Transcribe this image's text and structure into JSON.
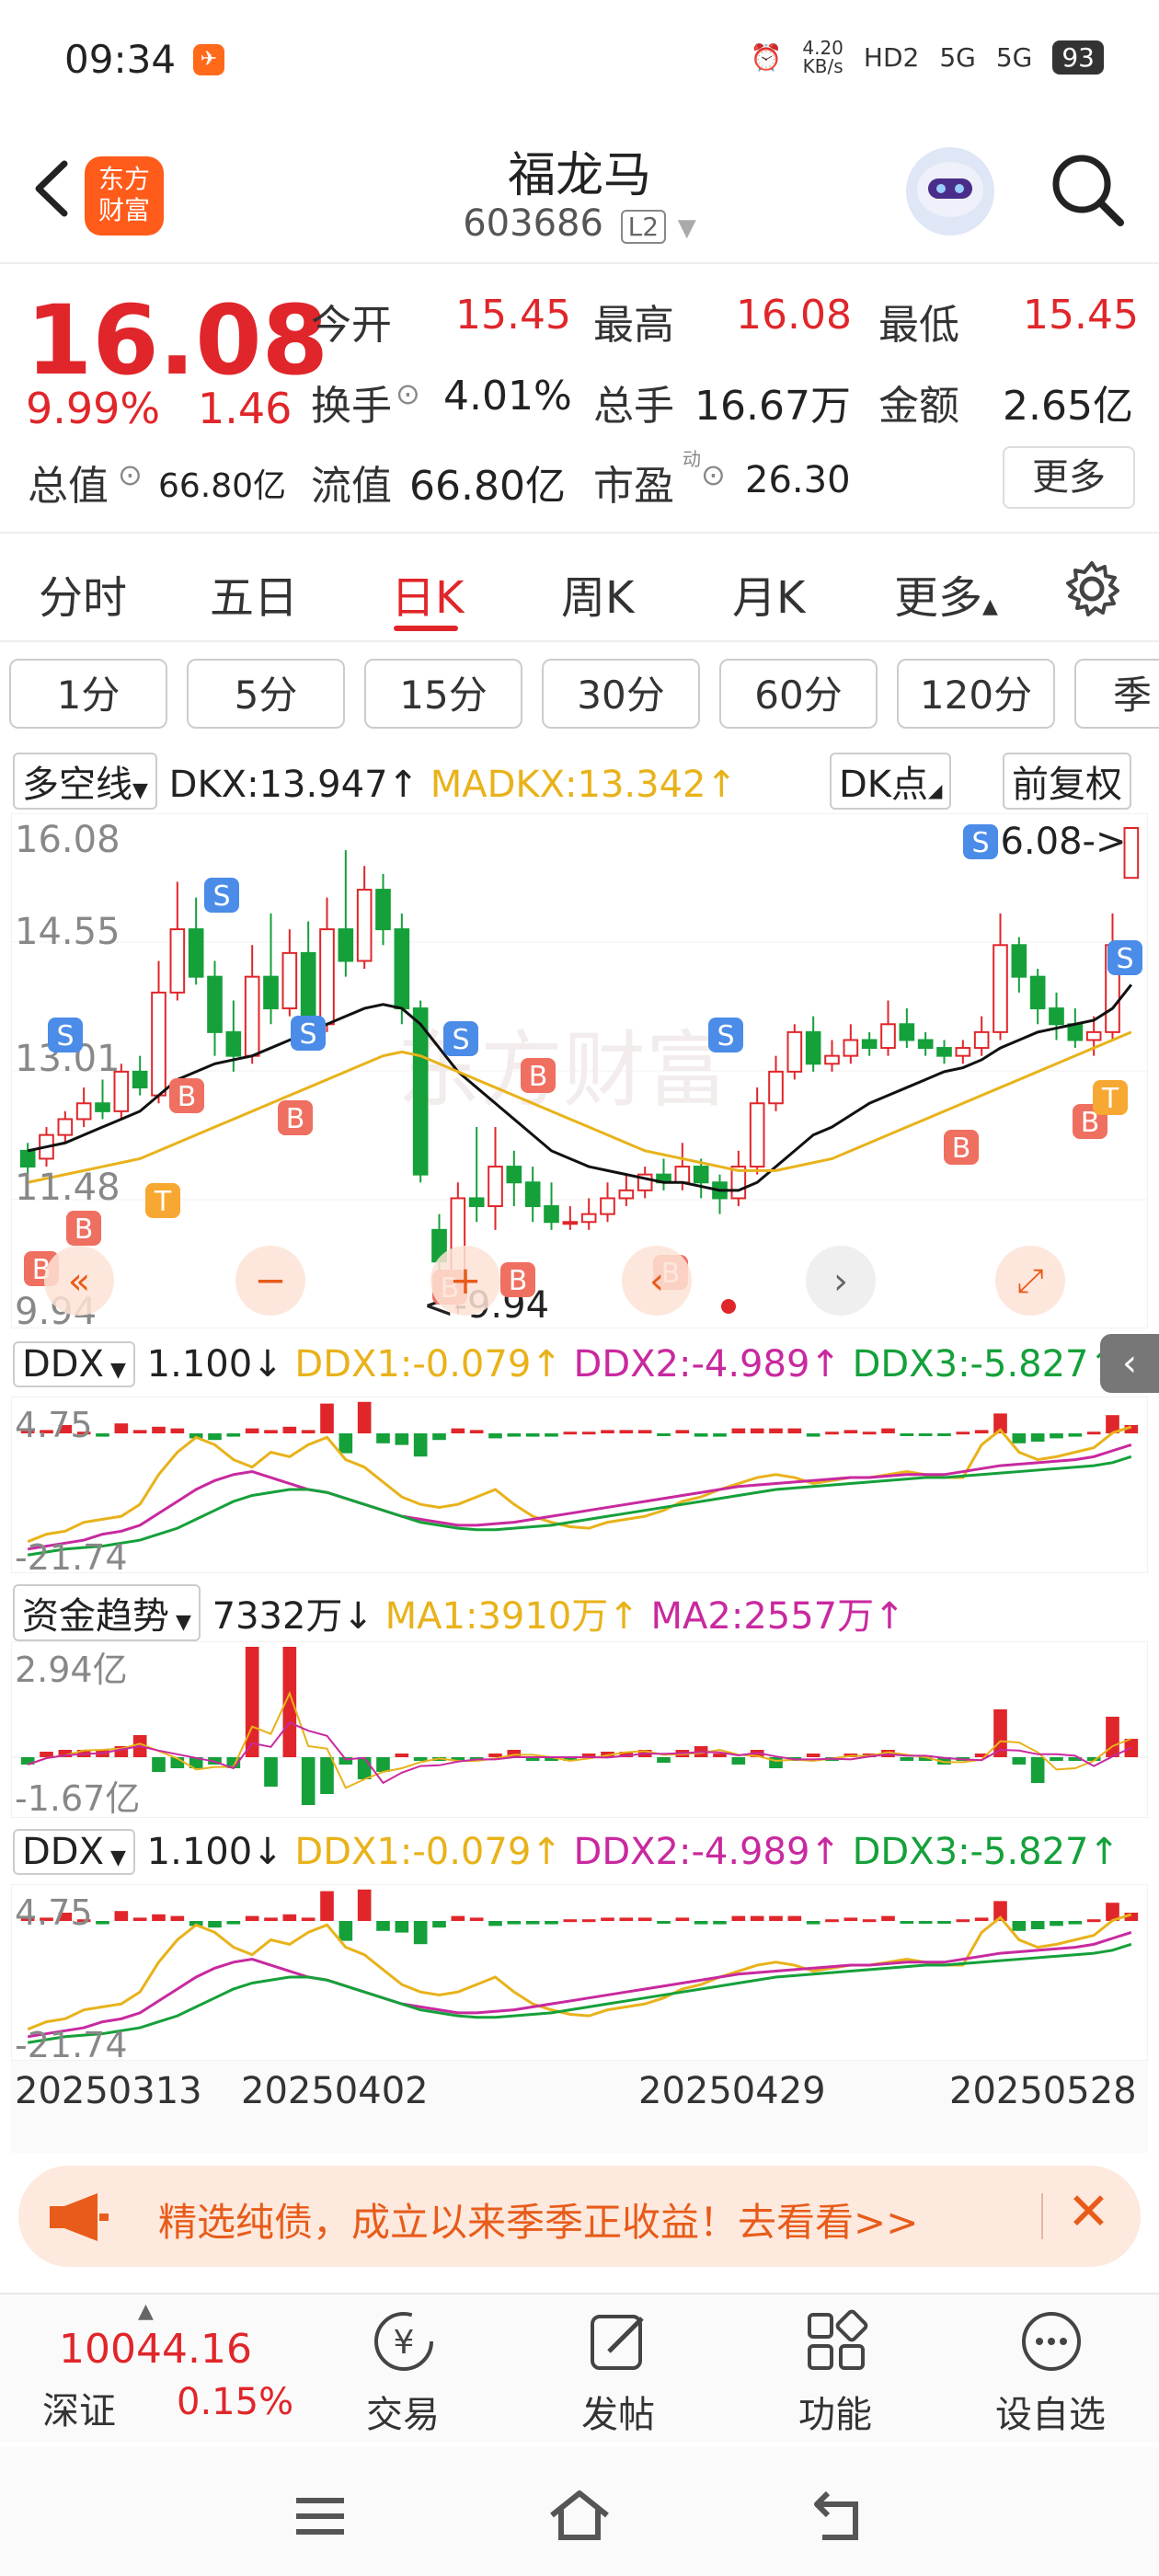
{
  "status_bar": {
    "time": "09:34",
    "net_speed": "4.20\nKB/s",
    "net_speed_top": "4.20",
    "net_speed_unit": "KB/s",
    "hd": "HD2",
    "signal1": "5G",
    "signal2": "5G",
    "battery": "93"
  },
  "header": {
    "brand_line1": "东方",
    "brand_line2": "财富",
    "stock_name": "福龙马",
    "stock_code": "603686",
    "level": "L2"
  },
  "quote": {
    "price": "16.08",
    "change_pct": "9.99%",
    "change": "1.46",
    "open_label": "今开",
    "open": "15.45",
    "high_label": "最高",
    "high": "16.08",
    "low_label": "最低",
    "low": "15.45",
    "turnover_label": "换手",
    "turnover": "4.01%",
    "volume_label": "总手",
    "volume": "16.67万",
    "amount_label": "金额",
    "amount": "2.65亿",
    "total_value_label": "总值",
    "total_value": "66.80亿",
    "float_value_label": "流值",
    "float_value": "66.80亿",
    "pe_label": "市盈",
    "pe_sup": "动",
    "pe": "26.30",
    "more_label": "更多"
  },
  "period_tabs": [
    "分时",
    "五日",
    "日K",
    "周K",
    "月K",
    "更多"
  ],
  "active_tab": "日K",
  "minute_buttons": [
    "1分",
    "5分",
    "15分",
    "30分",
    "60分",
    "120分",
    "季"
  ],
  "main_chart": {
    "indicator": "多空线",
    "dkx": "DKX:13.947",
    "madkx": "MADKX:13.342",
    "dk_button": "DK点",
    "adjust_button": "前复权",
    "y_labels": [
      "16.08",
      "14.55",
      "13.01",
      "11.48",
      "9.94"
    ],
    "max_label": "16.08->",
    "min_label": "<-9.94",
    "watermark": "东方财富"
  },
  "ddx_panel_1": {
    "name": "DDX",
    "ddx": "1.100",
    "ddx1": "DDX1:-0.079",
    "ddx2": "DDX2:-4.989",
    "ddx3": "DDX3:-5.827",
    "y_top": "4.75",
    "y_bottom": "-21.74"
  },
  "fund_panel": {
    "name": "资金趋势",
    "value": "7332万",
    "ma1": "MA1:3910万",
    "ma2": "MA2:2557万",
    "y_top": "2.94亿",
    "y_bottom": "-1.67亿"
  },
  "ddx_panel_2": {
    "name": "DDX",
    "ddx": "1.100",
    "ddx1": "DDX1:-0.079",
    "ddx2": "DDX2:-4.989",
    "ddx3": "DDX3:-5.827",
    "y_top": "4.75",
    "y_bottom": "-21.74"
  },
  "dates": [
    "20250313",
    "20250402",
    "20250429",
    "20250528"
  ],
  "banner": {
    "text": "精选纯债，成立以来季季正收益！去看看>>"
  },
  "bottom_nav": {
    "index_value": "10044.16",
    "index_name": "深证",
    "index_change": "0.15%",
    "items": [
      "交易",
      "发帖",
      "功能",
      "设自选"
    ]
  },
  "colors": {
    "up": "#e0262a",
    "down": "#15a03a",
    "dkx_line": "#111111",
    "madkx_line": "#e8b21a",
    "ddx2_line": "#c8299f",
    "accent": "#ff5b1a"
  },
  "chart_data": {
    "type": "candlestick",
    "ylim": [
      9.94,
      16.08
    ],
    "candles": [
      [
        12.0,
        11.8,
        12.1,
        11.7
      ],
      [
        11.9,
        12.2,
        12.3,
        11.8
      ],
      [
        12.2,
        12.4,
        12.5,
        12.1
      ],
      [
        12.4,
        12.6,
        12.8,
        12.3
      ],
      [
        12.6,
        12.5,
        12.9,
        12.4
      ],
      [
        12.5,
        13.0,
        13.1,
        12.4
      ],
      [
        13.0,
        12.8,
        13.2,
        12.7
      ],
      [
        12.7,
        14.0,
        14.4,
        12.6
      ],
      [
        14.0,
        14.8,
        15.4,
        13.9
      ],
      [
        14.8,
        14.2,
        15.2,
        14.1
      ],
      [
        14.2,
        13.5,
        14.4,
        13.2
      ],
      [
        13.5,
        13.2,
        13.9,
        13.0
      ],
      [
        13.2,
        14.2,
        14.6,
        13.1
      ],
      [
        14.2,
        13.8,
        15.0,
        13.6
      ],
      [
        13.8,
        14.5,
        14.8,
        13.7
      ],
      [
        14.5,
        13.6,
        14.9,
        13.4
      ],
      [
        13.6,
        14.8,
        15.2,
        13.5
      ],
      [
        14.8,
        14.4,
        15.8,
        14.2
      ],
      [
        14.4,
        15.3,
        15.6,
        14.3
      ],
      [
        15.3,
        14.8,
        15.5,
        14.6
      ],
      [
        14.8,
        13.8,
        15.0,
        13.6
      ],
      [
        13.8,
        11.7,
        13.9,
        11.6
      ],
      [
        11.0,
        10.6,
        11.2,
        10.4
      ],
      [
        10.4,
        11.4,
        11.6,
        9.94
      ],
      [
        11.4,
        11.3,
        12.3,
        11.1
      ],
      [
        11.3,
        11.8,
        12.3,
        11.0
      ],
      [
        11.8,
        11.6,
        12.0,
        11.3
      ],
      [
        11.6,
        11.3,
        11.8,
        11.1
      ],
      [
        11.3,
        11.1,
        11.6,
        11.0
      ],
      [
        11.1,
        11.1,
        11.3,
        11.0
      ],
      [
        11.1,
        11.2,
        11.4,
        11.0
      ],
      [
        11.2,
        11.4,
        11.6,
        11.1
      ],
      [
        11.4,
        11.5,
        11.7,
        11.3
      ],
      [
        11.5,
        11.7,
        11.8,
        11.4
      ],
      [
        11.7,
        11.6,
        11.9,
        11.5
      ],
      [
        11.6,
        11.8,
        12.1,
        11.5
      ],
      [
        11.8,
        11.6,
        11.9,
        11.4
      ],
      [
        11.6,
        11.4,
        11.7,
        11.2
      ],
      [
        11.4,
        11.8,
        12.0,
        11.3
      ],
      [
        11.8,
        12.6,
        12.8,
        11.7
      ],
      [
        12.6,
        13.0,
        13.2,
        12.5
      ],
      [
        13.0,
        13.5,
        13.6,
        12.9
      ],
      [
        13.5,
        13.1,
        13.7,
        13.0
      ],
      [
        13.1,
        13.2,
        13.4,
        13.0
      ],
      [
        13.2,
        13.4,
        13.6,
        13.1
      ],
      [
        13.4,
        13.3,
        13.5,
        13.2
      ],
      [
        13.3,
        13.6,
        13.9,
        13.2
      ],
      [
        13.6,
        13.4,
        13.8,
        13.3
      ],
      [
        13.4,
        13.3,
        13.5,
        13.2
      ],
      [
        13.3,
        13.2,
        13.4,
        13.1
      ],
      [
        13.2,
        13.3,
        13.4,
        13.1
      ],
      [
        13.3,
        13.5,
        13.7,
        13.2
      ],
      [
        13.5,
        14.6,
        15.0,
        13.4
      ],
      [
        14.6,
        14.2,
        14.7,
        14.0
      ],
      [
        14.2,
        13.8,
        14.3,
        13.6
      ],
      [
        13.8,
        13.6,
        14.0,
        13.4
      ],
      [
        13.6,
        13.4,
        13.8,
        13.3
      ],
      [
        13.4,
        13.5,
        13.7,
        13.2
      ],
      [
        13.5,
        14.6,
        15.0,
        13.4
      ],
      [
        15.45,
        16.08,
        16.08,
        15.45
      ]
    ],
    "dkx": [
      12.0,
      12.05,
      12.1,
      12.2,
      12.3,
      12.4,
      12.5,
      12.7,
      12.9,
      13.0,
      13.1,
      13.15,
      13.2,
      13.3,
      13.4,
      13.5,
      13.6,
      13.7,
      13.8,
      13.85,
      13.8,
      13.6,
      13.3,
      13.0,
      12.8,
      12.6,
      12.4,
      12.2,
      12.0,
      11.9,
      11.8,
      11.75,
      11.7,
      11.65,
      11.6,
      11.6,
      11.55,
      11.5,
      11.5,
      11.6,
      11.8,
      12.0,
      12.2,
      12.3,
      12.45,
      12.6,
      12.7,
      12.8,
      12.9,
      13.0,
      13.05,
      13.15,
      13.3,
      13.4,
      13.5,
      13.55,
      13.6,
      13.65,
      13.8,
      14.1
    ],
    "madkx": [
      11.6,
      11.65,
      11.7,
      11.75,
      11.8,
      11.85,
      11.9,
      12.0,
      12.1,
      12.2,
      12.3,
      12.4,
      12.5,
      12.6,
      12.7,
      12.8,
      12.9,
      13.0,
      13.1,
      13.2,
      13.25,
      13.2,
      13.1,
      13.0,
      12.9,
      12.8,
      12.7,
      12.6,
      12.5,
      12.4,
      12.3,
      12.2,
      12.1,
      12.0,
      11.95,
      11.9,
      11.85,
      11.8,
      11.75,
      11.75,
      11.75,
      11.8,
      11.85,
      11.9,
      12.0,
      12.1,
      12.2,
      12.3,
      12.4,
      12.5,
      12.6,
      12.7,
      12.8,
      12.9,
      13.0,
      13.1,
      13.2,
      13.3,
      13.4,
      13.5
    ]
  }
}
